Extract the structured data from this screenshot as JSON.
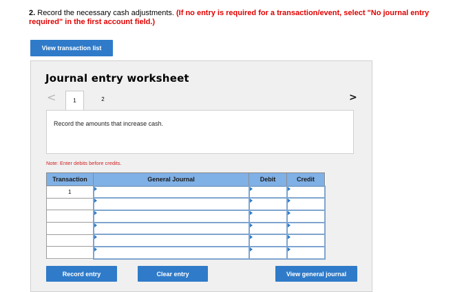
{
  "question": {
    "number": "2.",
    "text": " Record the necessary cash adjustments. ",
    "instruction": "(If no entry is required for a transaction/event, select \"No journal entry required\" in the first account field.)"
  },
  "buttons": {
    "view_transaction_list": "View transaction list",
    "record_entry": "Record entry",
    "clear_entry": "Clear entry",
    "view_general_journal": "View general journal"
  },
  "worksheet": {
    "title": "Journal entry worksheet",
    "nav_prev": "<",
    "nav_next": ">",
    "tabs": [
      "1",
      "2"
    ],
    "active_tab": "1",
    "prompt": "Record the amounts that increase cash.",
    "note": "Note: Enter debits before credits."
  },
  "journal_table": {
    "headers": {
      "transaction": "Transaction",
      "general_journal": "General Journal",
      "debit": "Debit",
      "credit": "Credit"
    },
    "rows": [
      {
        "transaction": "1",
        "account": "",
        "debit": "",
        "credit": ""
      },
      {
        "transaction": "",
        "account": "",
        "debit": "",
        "credit": ""
      },
      {
        "transaction": "",
        "account": "",
        "debit": "",
        "credit": ""
      },
      {
        "transaction": "",
        "account": "",
        "debit": "",
        "credit": ""
      },
      {
        "transaction": "",
        "account": "",
        "debit": "",
        "credit": ""
      },
      {
        "transaction": "",
        "account": "",
        "debit": "",
        "credit": ""
      }
    ]
  },
  "colors": {
    "accent": "#2f7bc9",
    "header_bg": "#7fb0e6",
    "instruction_red": "#e00000"
  }
}
